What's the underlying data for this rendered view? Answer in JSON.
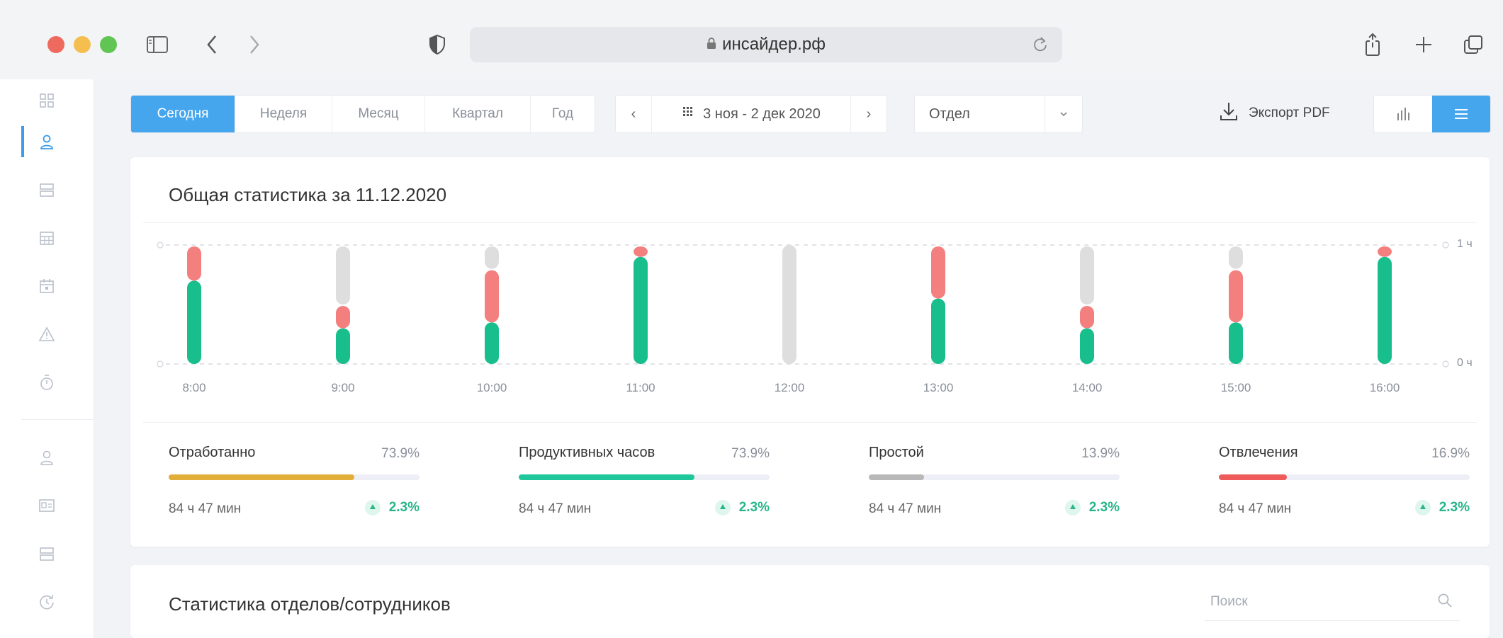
{
  "browser": {
    "url": "инсайдер.рф"
  },
  "toolbar": {
    "periods": [
      {
        "label": "Сегодня",
        "active": true
      },
      {
        "label": "Неделя",
        "active": false
      },
      {
        "label": "Месяц",
        "active": false
      },
      {
        "label": "Квартал",
        "active": false
      },
      {
        "label": "Год",
        "active": false
      }
    ],
    "date_range": "3 ноя - 2 дек 2020",
    "department_select": "Отдел",
    "export_label": "Экспорт PDF"
  },
  "stats_card": {
    "title": "Общая статистика за 11.12.2020"
  },
  "chart_data": {
    "type": "bar",
    "stacked": true,
    "categories": [
      "8:00",
      "9:00",
      "10:00",
      "11:00",
      "12:00",
      "13:00",
      "14:00",
      "15:00",
      "16:00"
    ],
    "series": [
      {
        "color": "#18be8c",
        "values": [
          0.7,
          0.3,
          0.35,
          0.9,
          0.0,
          0.55,
          0.3,
          0.35,
          0.9
        ]
      },
      {
        "color": "#f47f7f",
        "values": [
          0.3,
          0.2,
          0.45,
          0.1,
          0.0,
          0.45,
          0.2,
          0.45,
          0.1
        ]
      },
      {
        "color": "#dedede",
        "values": [
          0.0,
          0.5,
          0.2,
          0.0,
          1.0,
          0.0,
          0.5,
          0.2,
          0.0
        ]
      }
    ],
    "ylim": [
      0,
      1
    ],
    "y_ticks": [
      "0 ч",
      "1 ч"
    ],
    "grid": true
  },
  "metrics": [
    {
      "name": "Отработанно",
      "percent": "73.9%",
      "fill": 0.739,
      "color": "#e2ae3a",
      "duration": "84 ч 47 мин",
      "delta": "2.3%"
    },
    {
      "name": "Продуктивных часов",
      "percent": "73.9%",
      "fill": 0.7,
      "color": "#1fc79a",
      "duration": "84 ч 47 мин",
      "delta": "2.3%"
    },
    {
      "name": "Простой",
      "percent": "13.9%",
      "fill": 0.22,
      "color": "#b8b8b8",
      "duration": "84 ч 47 мин",
      "delta": "2.3%"
    },
    {
      "name": "Отвлечения",
      "percent": "16.9%",
      "fill": 0.27,
      "color": "#ef5a5a",
      "duration": "84 ч 47 мин",
      "delta": "2.3%"
    }
  ],
  "dept_card": {
    "title": "Статистика отделов/сотрудников",
    "search_placeholder": "Поиск"
  },
  "colors": {
    "accent": "#45a6ee",
    "productive": "#18be8c",
    "distraction": "#f47f7f",
    "idle": "#dedede"
  }
}
